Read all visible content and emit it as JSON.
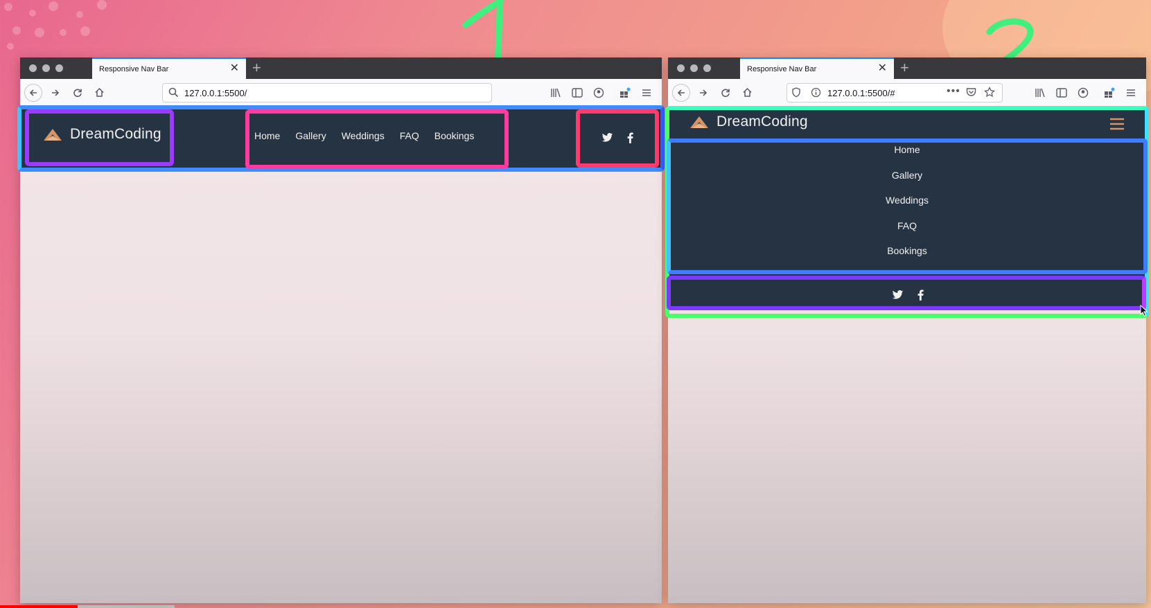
{
  "annotations": {
    "label_1": "1",
    "label_2": "2"
  },
  "colors": {
    "navbar": "#263343",
    "accent": "#d49466",
    "text": "#f1f1f1",
    "highlight_blue": "#3b6cff",
    "highlight_pink": "#ff3b8a",
    "highlight_purple": "#9b3bff",
    "highlight_green": "#3bff7a"
  },
  "window1": {
    "tab_title": "Responsive Nav Bar",
    "url": "127.0.0.1:5500/",
    "brand": "DreamCoding",
    "menu": [
      "Home",
      "Gallery",
      "Weddings",
      "FAQ",
      "Bookings"
    ],
    "icons": [
      "twitter-icon",
      "facebook-icon"
    ]
  },
  "window2": {
    "tab_title": "Responsive Nav Bar",
    "url": "127.0.0.1:5500/#",
    "brand": "DreamCoding",
    "menu": [
      "Home",
      "Gallery",
      "Weddings",
      "FAQ",
      "Bookings"
    ],
    "icons": [
      "hamburger-icon",
      "twitter-icon",
      "facebook-icon"
    ]
  }
}
